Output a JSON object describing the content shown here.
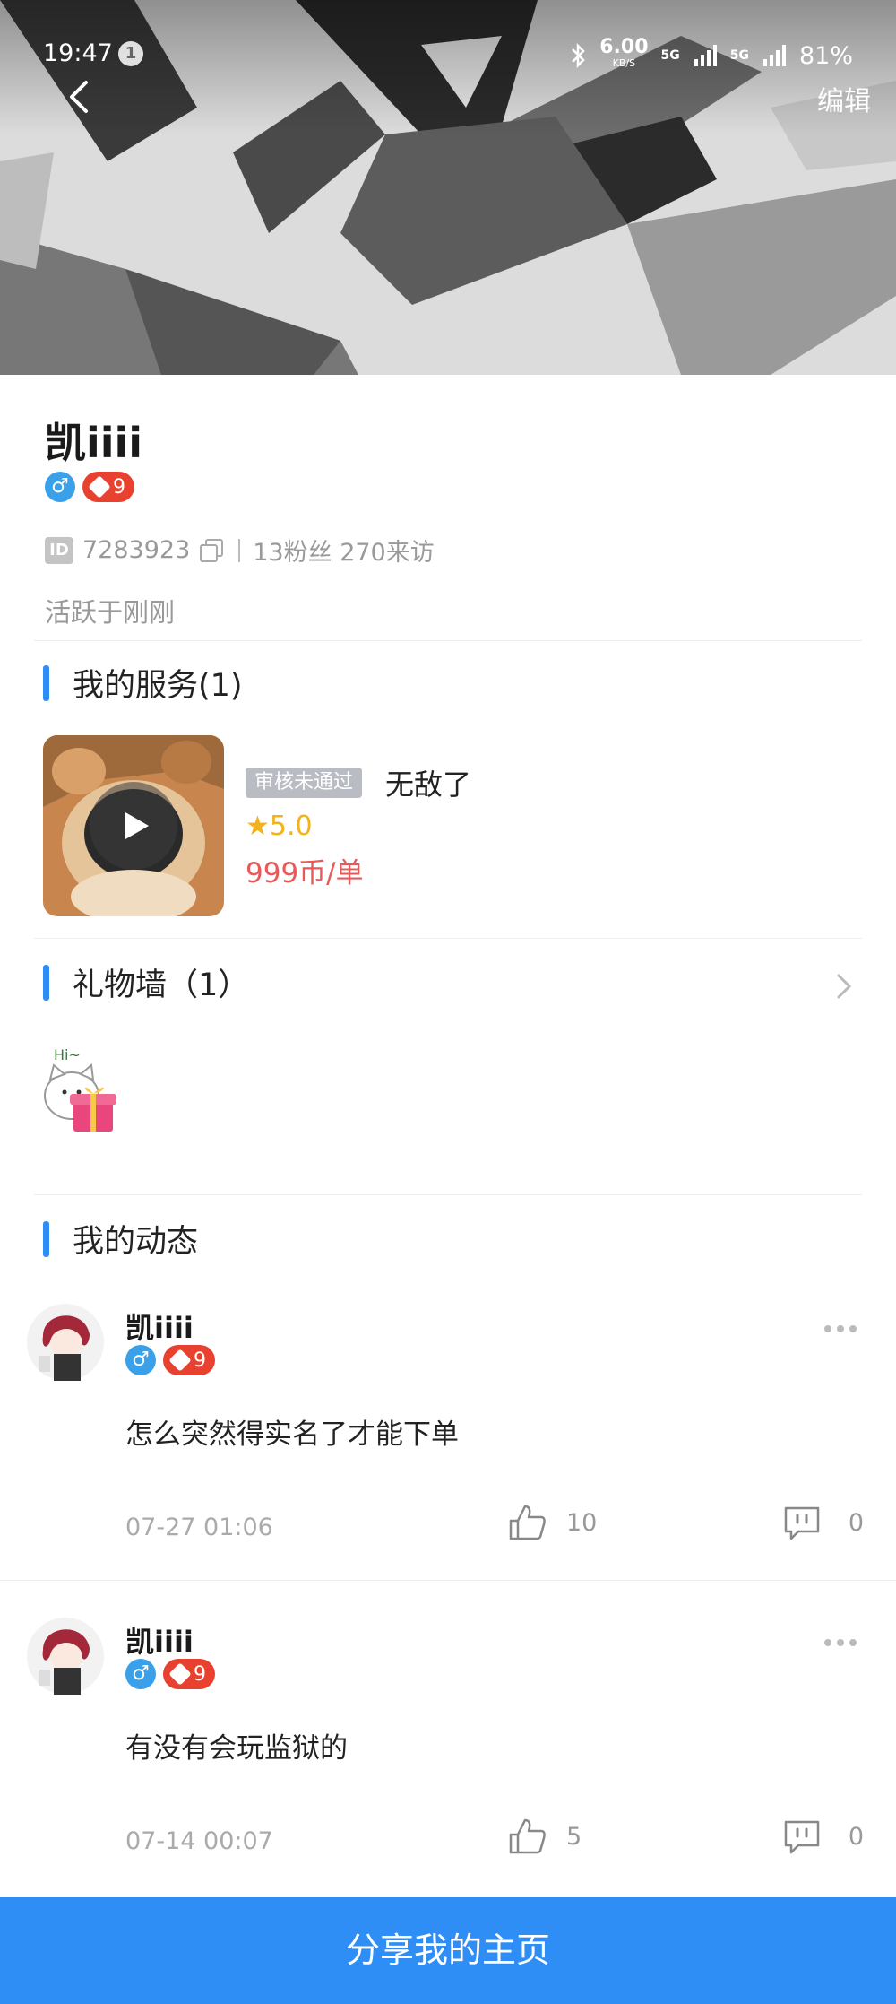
{
  "status_bar": {
    "time": "19:47",
    "notification_count": "1",
    "net_speed": "6.00",
    "net_speed_unit": "KB/S",
    "net_type_1": "5G",
    "net_type_2": "5G",
    "battery": "81%"
  },
  "header": {
    "edit_label": "编辑"
  },
  "profile": {
    "name": "凯iiii",
    "level": "9",
    "id_tag": "ID",
    "id": "7283923",
    "stats": "13粉丝 270来访",
    "active": "活跃于刚刚"
  },
  "services": {
    "title": "我的服务(1)",
    "item": {
      "review_status": "审核未通过",
      "name": "无敌了",
      "rating": "★5.0",
      "price": "999币/单"
    }
  },
  "gifts": {
    "title": "礼物墙（1）",
    "gift_badge_text": "Hi~"
  },
  "feed": {
    "title": "我的动态",
    "posts": [
      {
        "name": "凯iiii",
        "level": "9",
        "content": "怎么突然得实名了才能下单",
        "date": "07-27 01:06",
        "likes": "10",
        "comments": "0"
      },
      {
        "name": "凯iiii",
        "level": "9",
        "content": "有没有会玩监狱的",
        "date": "07-14 00:07",
        "likes": "5",
        "comments": "0"
      }
    ]
  },
  "bottom": {
    "share_label": "分享我的主页"
  },
  "colors": {
    "accent": "#2f8ef5",
    "level_badge": "#e9412f",
    "gender_badge": "#3aa0ea",
    "rating": "#f3b21a",
    "price": "#e85a5a"
  }
}
